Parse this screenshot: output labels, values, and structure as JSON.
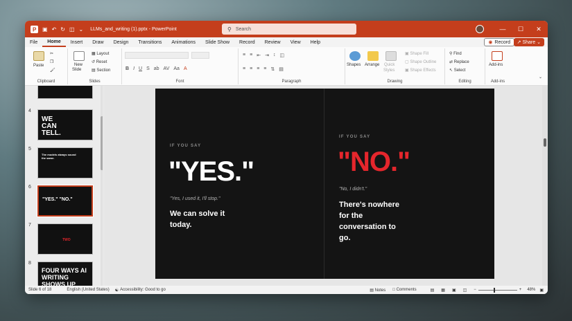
{
  "window": {
    "filename": "LLMs_and_writing (1).pptx",
    "app": "PowerPoint",
    "separator": "-",
    "search_placeholder": "Search"
  },
  "menu": {
    "tabs": [
      "File",
      "Home",
      "Insert",
      "Draw",
      "Design",
      "Transitions",
      "Animations",
      "Slide Show",
      "Record",
      "Review",
      "View",
      "Help"
    ],
    "active": "Home",
    "record_label": "Record",
    "share_label": "Share"
  },
  "ribbon": {
    "clipboard": {
      "paste": "Paste",
      "label": "Clipboard"
    },
    "slides": {
      "new_slide": "New",
      "new_slide2": "Slide",
      "layout": "Layout",
      "reset": "Reset",
      "section": "Section",
      "label": "Slides"
    },
    "font": {
      "label": "Font",
      "buttons": [
        "B",
        "I",
        "U",
        "S",
        "ab",
        "AV",
        "Aa"
      ]
    },
    "paragraph": {
      "label": "Paragraph"
    },
    "drawing": {
      "shapes": "Shapes",
      "arrange": "Arrange",
      "quick_styles": "Quick",
      "quick_styles2": "Styles",
      "shape_fill": "Shape Fill",
      "shape_outline": "Shape Outline",
      "shape_effects": "Shape Effects",
      "label": "Drawing"
    },
    "editing": {
      "find": "Find",
      "replace": "Replace",
      "select": "Select",
      "label": "Editing"
    },
    "addins": {
      "addins": "Add-ins",
      "label": "Add-ins"
    }
  },
  "thumbnails": [
    {
      "num": "4",
      "title": "WE CAN TELL."
    },
    {
      "num": "5",
      "title": "The models always sound the same."
    },
    {
      "num": "6",
      "title": "\"YES.\"  \"NO.\""
    },
    {
      "num": "7",
      "title": "TWO"
    },
    {
      "num": "8",
      "title": "FOUR WAYS AI WRITING SHOWS UP"
    }
  ],
  "slide": {
    "left": {
      "pre": "IF YOU SAY",
      "headline": "\"YES.\"",
      "quote": "\"Yes, I used it, I'll stop.\"",
      "body": "We can solve it today."
    },
    "right": {
      "pre": "IF YOU SAY",
      "headline": "\"NO.\"",
      "quote": "\"No, I didn't.\"",
      "body": "There's nowhere for the conversation to go."
    }
  },
  "status": {
    "slide_info": "Slide 6 of 18",
    "language": "English (United States)",
    "accessibility": "Accessibility: Good to go",
    "notes": "Notes",
    "comments": "Comments",
    "zoom": "48%"
  },
  "colors": {
    "accent": "#c43e1c",
    "slide_red": "#e5262c",
    "slide_bg": "#141414"
  }
}
